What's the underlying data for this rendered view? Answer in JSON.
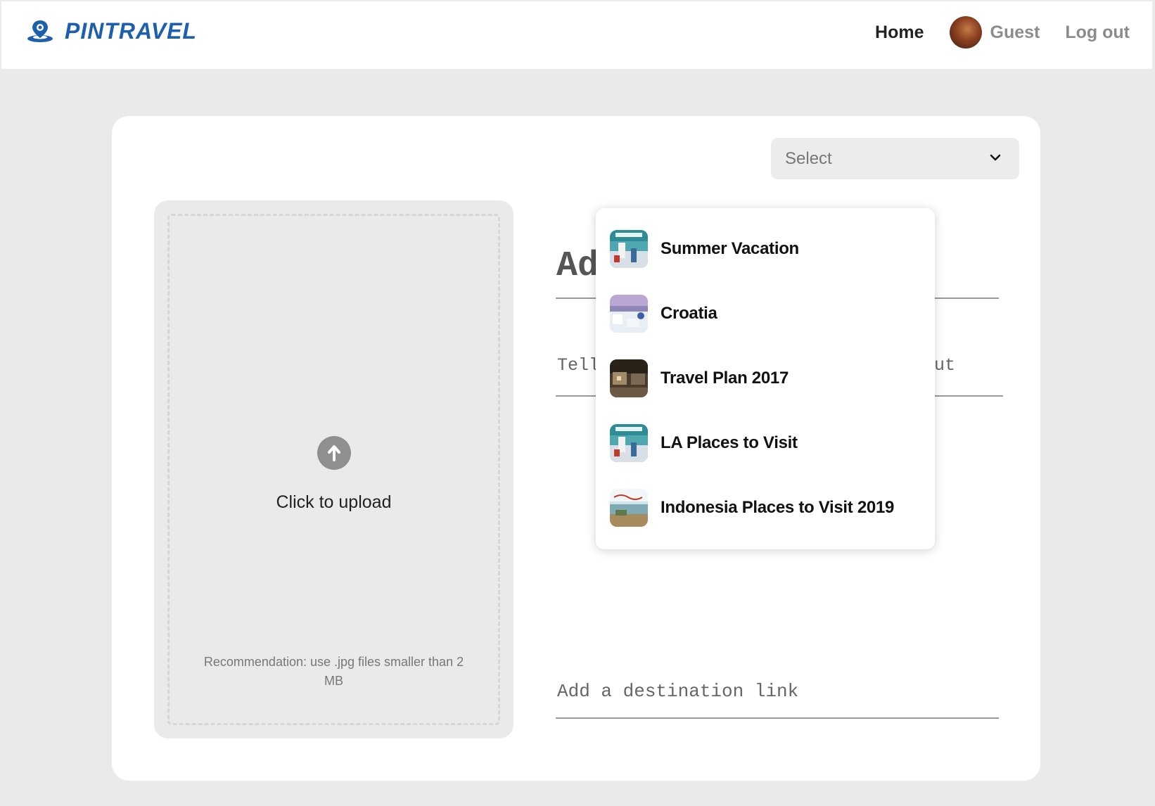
{
  "header": {
    "brand": "PINTRAVEL",
    "nav": {
      "home": "Home",
      "user": "Guest",
      "logout": "Log out"
    }
  },
  "board_select": {
    "value": "Select",
    "options": [
      {
        "label": "Summer Vacation",
        "thumb": "los-angeles-poster"
      },
      {
        "label": "Croatia",
        "thumb": "coastal-town"
      },
      {
        "label": "Travel Plan 2017",
        "thumb": "city-street"
      },
      {
        "label": "LA Places to Visit",
        "thumb": "los-angeles-poster"
      },
      {
        "label": "Indonesia Places to Visit 2019",
        "thumb": "romantic-islands"
      }
    ]
  },
  "upload": {
    "label": "Click to upload",
    "recommendation": "Recommendation: use .jpg files smaller than 2 MB"
  },
  "form": {
    "title_visible": "Ad",
    "about_visible_left": "Tell",
    "about_visible_right": "ut",
    "link_placeholder": "Add a destination link"
  },
  "colors": {
    "brand": "#1c5fad",
    "background": "#eaeaea"
  }
}
